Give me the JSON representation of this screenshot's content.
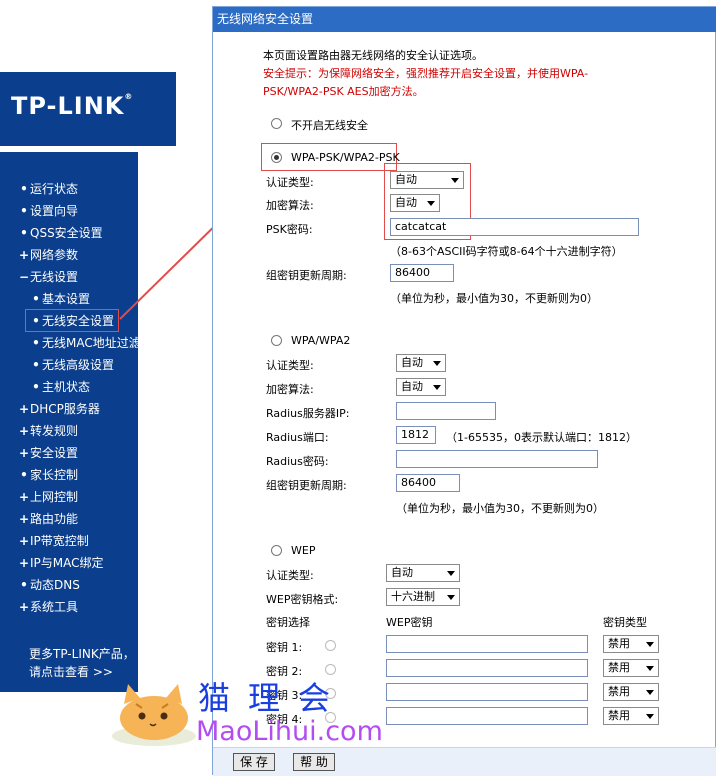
{
  "brand": {
    "logo_text": "TP-LINK",
    "reg_mark": "®"
  },
  "nav": {
    "items": [
      {
        "mark": "•",
        "label": "运行状态"
      },
      {
        "mark": "•",
        "label": "设置向导"
      },
      {
        "mark": "•",
        "label": "QSS安全设置"
      },
      {
        "mark": "+",
        "label": "网络参数"
      },
      {
        "mark": "−",
        "label": "无线设置"
      },
      {
        "mark": "•",
        "label": "基本设置"
      },
      {
        "mark": "•",
        "label": "无线安全设置"
      },
      {
        "mark": "•",
        "label": "无线MAC地址过滤"
      },
      {
        "mark": "•",
        "label": "无线高级设置"
      },
      {
        "mark": "•",
        "label": "主机状态"
      },
      {
        "mark": "+",
        "label": "DHCP服务器"
      },
      {
        "mark": "+",
        "label": "转发规则"
      },
      {
        "mark": "+",
        "label": "安全设置"
      },
      {
        "mark": "•",
        "label": "家长控制"
      },
      {
        "mark": "+",
        "label": "上网控制"
      },
      {
        "mark": "+",
        "label": "路由功能"
      },
      {
        "mark": "+",
        "label": "IP带宽控制"
      },
      {
        "mark": "+",
        "label": "IP与MAC绑定"
      },
      {
        "mark": "•",
        "label": "动态DNS"
      },
      {
        "mark": "+",
        "label": "系统工具"
      }
    ],
    "more_line1": "更多TP-LINK产品，",
    "more_line2": "请点击查看 >>"
  },
  "panel": {
    "title": "无线网络安全设置",
    "intro": "本页面设置路由器无线网络的安全认证选项。",
    "warn1": "安全提示：为保障网络安全，强烈推荐开启安全设置，并使用WPA-",
    "warn2": "PSK/WPA2-PSK AES加密方法。",
    "none_label": "不开启无线安全",
    "psk": {
      "label": "WPA-PSK/WPA2-PSK",
      "auth_label": "认证类型:",
      "auth_value": "自动",
      "enc_label": "加密算法:",
      "enc_value": "自动",
      "pwd_label": "PSK密码:",
      "pwd_value": "catcatcat",
      "pwd_hint": "（8-63个ASCII码字符或8-64个十六进制字符）",
      "renew_label": "组密钥更新周期:",
      "renew_value": "86400",
      "renew_hint": "（单位为秒，最小值为30，不更新则为0）"
    },
    "wpa": {
      "label": "WPA/WPA2",
      "auth_label": "认证类型:",
      "auth_value": "自动",
      "enc_label": "加密算法:",
      "enc_value": "自动",
      "radius_ip_label": "Radius服务器IP:",
      "radius_ip_value": "",
      "radius_port_label": "Radius端口:",
      "radius_port_value": "1812",
      "radius_port_hint": "（1-65535，0表示默认端口：1812）",
      "radius_pwd_label": "Radius密码:",
      "radius_pwd_value": "",
      "renew_label": "组密钥更新周期:",
      "renew_value": "86400",
      "renew_hint": "（单位为秒，最小值为30，不更新则为0）"
    },
    "wep": {
      "label": "WEP",
      "auth_label": "认证类型:",
      "auth_value": "自动",
      "fmt_label": "WEP密钥格式:",
      "fmt_value": "十六进制",
      "col_select": "密钥选择",
      "col_key": "WEP密钥",
      "col_type": "密钥类型",
      "keys": [
        {
          "label": "密钥 1:",
          "value": "",
          "type": "禁用"
        },
        {
          "label": "密钥 2:",
          "value": "",
          "type": "禁用"
        },
        {
          "label": "密钥 3:",
          "value": "",
          "type": "禁用"
        },
        {
          "label": "密钥 4:",
          "value": "",
          "type": "禁用"
        }
      ]
    },
    "save_label": "保 存",
    "help_label": "帮 助"
  },
  "watermark": {
    "cn": "猫理会",
    "en": "MaoLihui.com"
  },
  "colors": {
    "nav_bg": "#0b3e8c",
    "title_bar": "#2c6cc4",
    "warning": "#d00000",
    "highlight": "#e34b4b"
  }
}
